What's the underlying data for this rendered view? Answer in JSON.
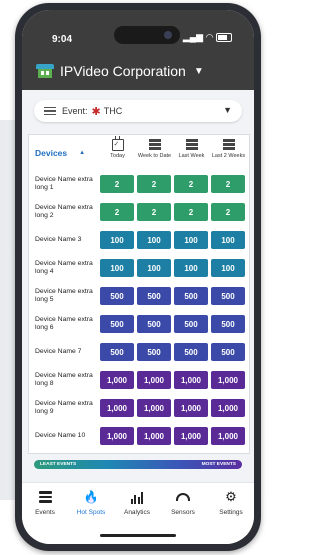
{
  "status_bar": {
    "time": "9:04",
    "signal": "▂▄▆"
  },
  "app": {
    "title": "IPVideo Corporation",
    "caret": "▼"
  },
  "event_filter": {
    "label": "Event:",
    "value": "THC",
    "caret": "▼",
    "icon": "cannabis-leaf-icon"
  },
  "grid": {
    "devices_header": "Devices",
    "sort_indicator": "▲",
    "columns": [
      {
        "label": "Today",
        "icon": "calendar-check-icon"
      },
      {
        "label": "Week to Date",
        "icon": "stack-icon"
      },
      {
        "label": "Last Week",
        "icon": "stack-icon"
      },
      {
        "label": "Last 2 Weeks",
        "icon": "stack-icon"
      }
    ],
    "rows": [
      {
        "name": "Device Name extra long 1",
        "values": [
          "2",
          "2",
          "2",
          "2"
        ],
        "level": "green"
      },
      {
        "name": "Device Name extra long 2",
        "values": [
          "2",
          "2",
          "2",
          "2"
        ],
        "level": "green"
      },
      {
        "name": "Device Name 3",
        "values": [
          "100",
          "100",
          "100",
          "100"
        ],
        "level": "teal"
      },
      {
        "name": "Device Name extra long 4",
        "values": [
          "100",
          "100",
          "100",
          "100"
        ],
        "level": "teal"
      },
      {
        "name": "Device Name extra long 5",
        "values": [
          "500",
          "500",
          "500",
          "500"
        ],
        "level": "indigo"
      },
      {
        "name": "Device Name extra long 6",
        "values": [
          "500",
          "500",
          "500",
          "500"
        ],
        "level": "indigo"
      },
      {
        "name": "Device Name 7",
        "values": [
          "500",
          "500",
          "500",
          "500"
        ],
        "level": "indigo"
      },
      {
        "name": "Device Name extra long 8",
        "values": [
          "1,000",
          "1,000",
          "1,000",
          "1,000"
        ],
        "level": "purple"
      },
      {
        "name": "Device Name extra long 9",
        "values": [
          "1,000",
          "1,000",
          "1,000",
          "1,000"
        ],
        "level": "purple"
      },
      {
        "name": "Device Name 10",
        "values": [
          "1,000",
          "1,000",
          "1,000",
          "1,000"
        ],
        "level": "purple"
      }
    ]
  },
  "legend": {
    "low": "LEAST EVENTS",
    "high": "MOST EVENTS"
  },
  "colors": {
    "green": "#2e9d6a",
    "teal": "#1d7fa3",
    "indigo": "#3b4aa8",
    "purple": "#5a2a96",
    "accent": "#1f77d6"
  },
  "tabs": [
    {
      "label": "Events",
      "icon": "list-icon",
      "active": false
    },
    {
      "label": "Hot Spots",
      "icon": "flame-icon",
      "active": true
    },
    {
      "label": "Analytics",
      "icon": "analytics-icon",
      "active": false
    },
    {
      "label": "Sensors",
      "icon": "gauge-icon",
      "active": false
    },
    {
      "label": "Settings",
      "icon": "gear-icon",
      "active": false
    }
  ]
}
